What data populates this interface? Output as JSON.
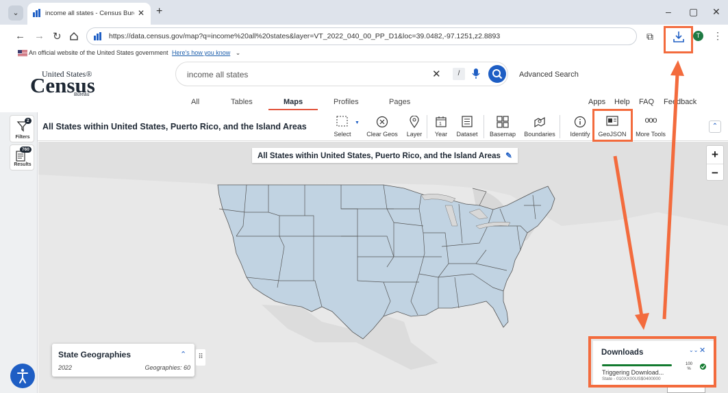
{
  "browser": {
    "tab_title": "income all states - Census Bureau",
    "tab_close": "✕",
    "new_tab": "+",
    "window_controls": [
      "–",
      "▢",
      "✕"
    ],
    "url": "https://data.census.gov/map?q=income%20all%20states&layer=VT_2022_040_00_PP_D1&loc=39.0482,-97.1251,z2.8893",
    "profile_initial": "T",
    "accent": "#f36b3d"
  },
  "gov_banner": {
    "text": "An official website of the United States government",
    "link": "Here's how you know",
    "chevron": "⌄"
  },
  "census": {
    "logo_top": "United States®",
    "logo_main": "Census",
    "logo_sub": "Bureau",
    "search_value": "income all states",
    "search_key_hint": "/",
    "advanced_search": "Advanced Search",
    "nav_tabs": [
      "All",
      "Tables",
      "Maps",
      "Profiles",
      "Pages"
    ],
    "active_tab": "Maps",
    "util_links": [
      "Apps",
      "Help",
      "FAQ",
      "Feedback"
    ]
  },
  "left_rail": {
    "filters_label": "Filters",
    "filters_badge": "2",
    "results_label": "Results",
    "results_badge": "760"
  },
  "map_toolbar": {
    "title": "All States within United States, Puerto Rico, and the Island Areas",
    "tools": [
      "Select",
      "Clear Geos",
      "Layer",
      "Year",
      "Dataset",
      "Basemap",
      "Boundaries",
      "Identify",
      "GeoJSON",
      "More Tools"
    ]
  },
  "map": {
    "label": "All States within United States, Puerto Rico, and the Island Areas",
    "zoom_in": "+",
    "zoom_out": "−",
    "state_fill": "#c1d3e2"
  },
  "geo_card": {
    "title": "State Geographies",
    "year": "2022",
    "count": "Geographies: 60"
  },
  "downloads": {
    "title": "Downloads",
    "progress_pct": 100,
    "pct_label": "100 %",
    "status": "Triggering Download...",
    "file": "State - 010XX00US$0400000"
  }
}
